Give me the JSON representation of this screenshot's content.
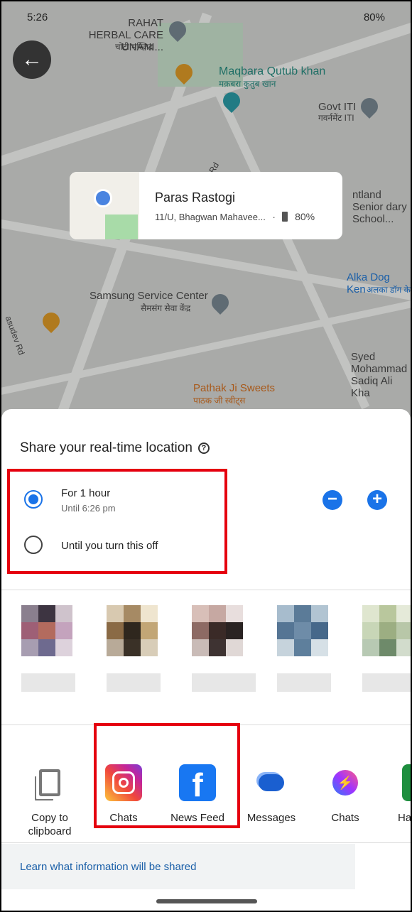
{
  "status_bar": {
    "time": "5:26",
    "battery": "80%",
    "icons": [
      "instagram-icon",
      "youtube-icon",
      "twitter-icon",
      "gmail-icon",
      "alarm-icon",
      "bluetooth-icon",
      "location-icon",
      "volte-icon",
      "wifi-icon",
      "signal-icon",
      "battery-icon"
    ]
  },
  "map": {
    "labels": [
      {
        "text": "RAHAT HERBAL CARE UNANI...",
        "color": "#3a3a3a"
      },
      {
        "text": "चोटी मस्जिद",
        "color": "#3a3a3a"
      },
      {
        "text": "Maqbara Qutub khan",
        "color": "#1f6f66"
      },
      {
        "text": "मक़बरा कुतुब खान",
        "color": "#1f6f66"
      },
      {
        "text": "Govt ITI",
        "color": "#3a3a3a"
      },
      {
        "text": "गवर्नमेंट ITI",
        "color": "#3a3a3a"
      },
      {
        "text": "ntland Senior dary School...",
        "color": "#3a3a3a"
      },
      {
        "text": "Alka Dog Ken",
        "color": "#1a5fa8"
      },
      {
        "text": "अलका डॉग के",
        "color": "#1a5fa8"
      },
      {
        "text": "Samsung Service Center",
        "color": "#3a3a3a"
      },
      {
        "text": "सैमसंग सेवा केंद्र",
        "color": "#3a3a3a"
      },
      {
        "text": "Syed Mohammad Sadiq Ali Kha",
        "color": "#3a3a3a"
      },
      {
        "text": "Pathak Ji Sweets",
        "color": "#a8591a"
      },
      {
        "text": "पाठक जी स्वीट्स",
        "color": "#a8591a"
      },
      {
        "text": "Rd",
        "color": "#3a3a3a"
      },
      {
        "text": "asudev Rd",
        "color": "#3a3a3a"
      }
    ]
  },
  "location_card": {
    "name": "Paras Rastogi",
    "address": "11/U, Bhagwan Mahavee...",
    "separator": "·",
    "battery": "80%"
  },
  "sheet": {
    "title": "Share your real-time location",
    "options": [
      {
        "label": "For 1 hour",
        "sublabel": "Until 6:26 pm",
        "selected": true
      },
      {
        "label": "Until you turn this off",
        "selected": false
      }
    ],
    "decrease": "−",
    "increase": "+",
    "apps": [
      {
        "label": "Copy to clipboard",
        "icon": "copy-icon"
      },
      {
        "label": "Chats",
        "icon": "instagram-icon"
      },
      {
        "label": "News Feed",
        "icon": "facebook-icon"
      },
      {
        "label": "Messages",
        "icon": "messages-icon"
      },
      {
        "label": "Chats",
        "icon": "messenger-icon"
      },
      {
        "label": "Ha",
        "icon": "hangouts-icon"
      }
    ],
    "learn_link": "Learn what information will be shared"
  },
  "colors": {
    "accent": "#1a73e8",
    "highlight": "#e5000f",
    "link": "#1a5fa8"
  }
}
